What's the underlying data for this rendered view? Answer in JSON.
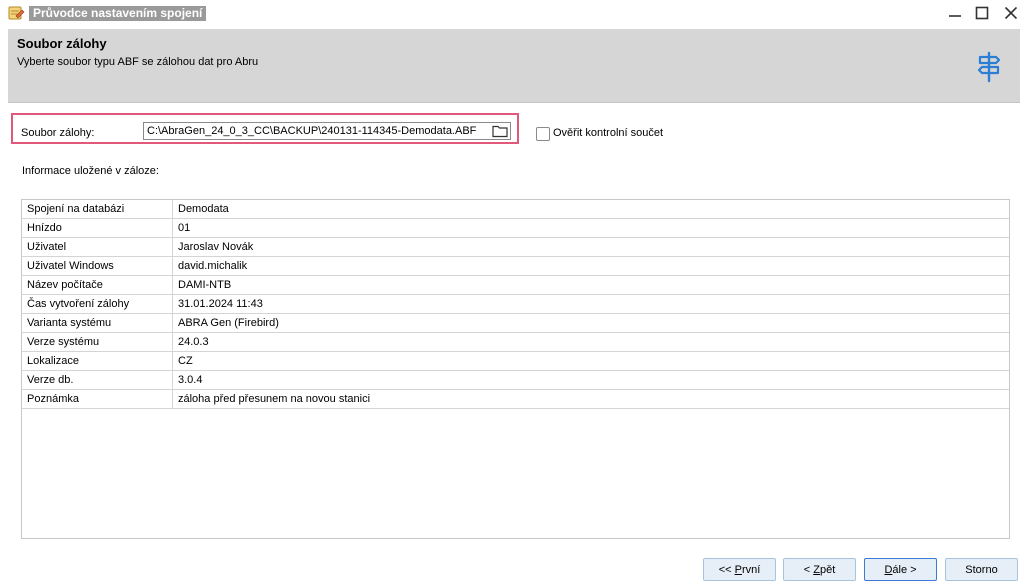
{
  "window": {
    "title": "Průvodce nastavením spojení"
  },
  "header": {
    "title": "Soubor zálohy",
    "subtitle": "Vyberte soubor typu ABF se zálohou dat pro Abru"
  },
  "file": {
    "label": "Soubor zálohy:",
    "value": "C:\\AbraGen_24_0_3_CC\\BACKUP\\240131-114345-Demodata.ABF"
  },
  "checksum": {
    "label": "Ověřit kontrolní součet",
    "checked": false
  },
  "info": {
    "label": "Informace uložené v záloze:",
    "rows": [
      {
        "key": "Spojení na databázi",
        "value": "Demodata"
      },
      {
        "key": "Hnízdo",
        "value": "01"
      },
      {
        "key": "Uživatel",
        "value": "Jaroslav Novák"
      },
      {
        "key": "Uživatel Windows",
        "value": "david.michalik"
      },
      {
        "key": "Název počítače",
        "value": "DAMI-NTB"
      },
      {
        "key": "Čas vytvoření zálohy",
        "value": "31.01.2024 11:43"
      },
      {
        "key": "Varianta systému",
        "value": "ABRA Gen (Firebird)"
      },
      {
        "key": "Verze systému",
        "value": "24.0.3"
      },
      {
        "key": "Lokalizace",
        "value": "CZ"
      },
      {
        "key": "Verze db.",
        "value": "3.0.4"
      },
      {
        "key": "Poznámka",
        "value": "záloha před přesunem na novou stanici"
      }
    ]
  },
  "buttons": {
    "first": {
      "prefix": "<< ",
      "access": "P",
      "rest": "rvní"
    },
    "back": {
      "prefix": "< ",
      "access": "Z",
      "rest": "pět"
    },
    "next": {
      "access": "D",
      "rest": "ále >"
    },
    "cancel": {
      "label": "Storno"
    }
  },
  "colors": {
    "highlight": "#e0587a",
    "accent": "#2a7fd4",
    "header_bg": "#d6d6d6"
  }
}
